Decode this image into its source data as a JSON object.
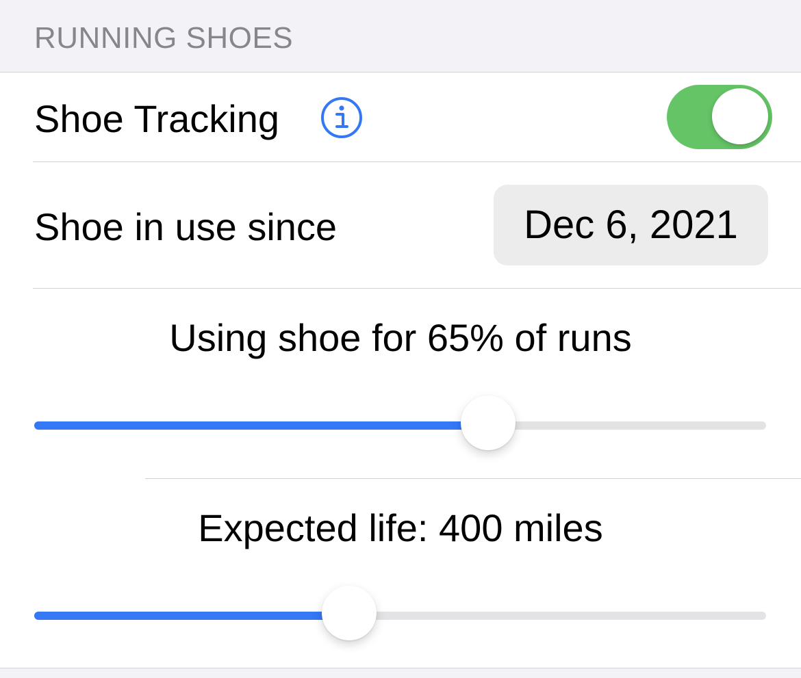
{
  "section": {
    "header": "RUNNING SHOES"
  },
  "shoe_tracking": {
    "label": "Shoe Tracking",
    "info_icon": "info-circle-icon",
    "toggle_on": true
  },
  "in_use_since": {
    "label": "Shoe in use since",
    "date": "Dec 6, 2021"
  },
  "usage": {
    "label": "Using shoe for 65% of runs",
    "slider_fraction": 0.62
  },
  "expected_life": {
    "label": "Expected life: 400 miles",
    "slider_fraction": 0.43
  },
  "colors": {
    "accent": "#3478f6",
    "toggle_on": "#65c466",
    "header_text": "#86868b",
    "background": "#f2f2f7"
  }
}
